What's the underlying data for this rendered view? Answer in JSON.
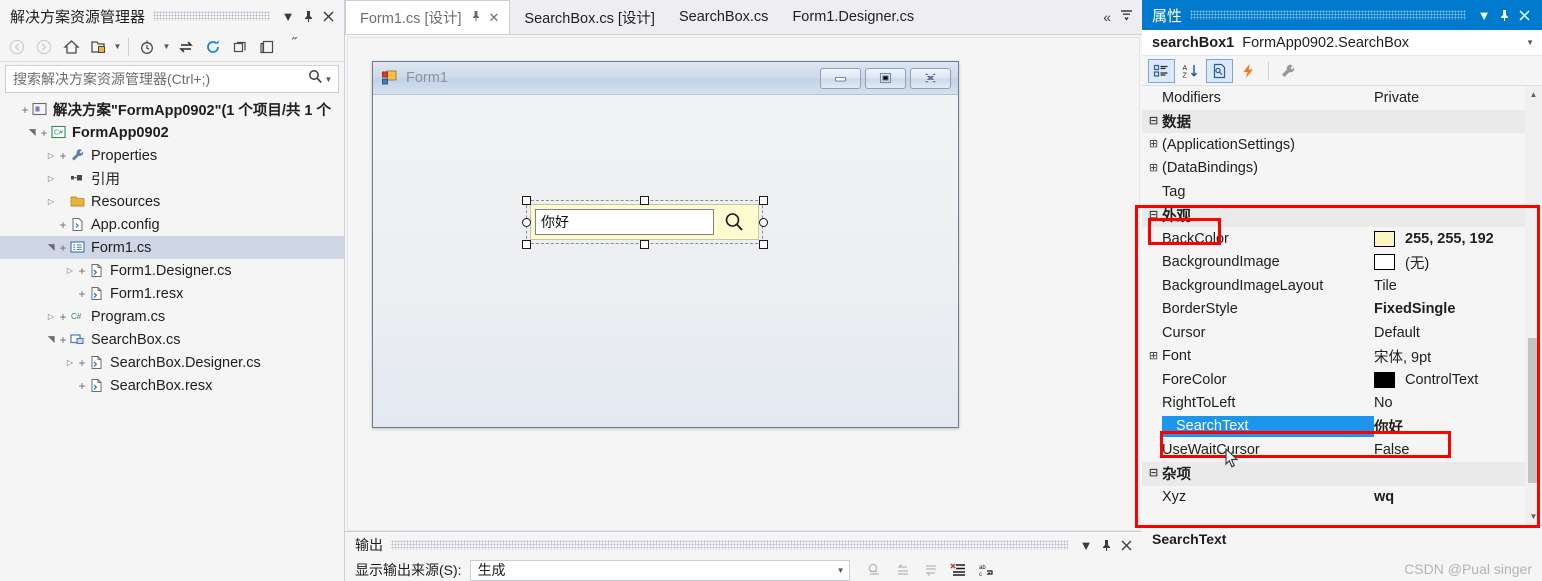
{
  "solution_explorer": {
    "title": "解决方案资源管理器",
    "titlebar_buttons": [
      "dropdown-icon",
      "pin-icon",
      "close-icon"
    ],
    "toolbar": [
      {
        "name": "back-button",
        "icon": "back-arrow-icon",
        "disabled": true
      },
      {
        "name": "forward-button",
        "icon": "forward-arrow-icon",
        "disabled": true
      },
      {
        "name": "home-button",
        "icon": "home-icon",
        "disabled": false
      },
      {
        "name": "show-all-files-button",
        "icon": "folder-open-icon",
        "disabled": false
      },
      {
        "name": "pending-changes-button",
        "icon": "clock-icon",
        "disabled": false
      },
      {
        "name": "sync-button",
        "icon": "sync-arrows-icon",
        "disabled": false
      },
      {
        "name": "refresh-button",
        "icon": "refresh-icon",
        "disabled": false
      },
      {
        "name": "collapse-all-button",
        "icon": "collapse-icon",
        "disabled": false
      },
      {
        "name": "properties-button",
        "icon": "properties-page-icon",
        "disabled": false
      },
      {
        "name": "overflow-button",
        "icon": "overflow-dots-icon",
        "disabled": false
      }
    ],
    "search": {
      "placeholder": "搜索解决方案资源管理器(Ctrl+;)",
      "icon": "search-icon",
      "caret": "dropdown-caret-icon"
    },
    "tree": [
      {
        "depth": 0,
        "expander": "",
        "plus": "+",
        "icon": "solution-icon",
        "label": "解决方案\"FormApp0902\"(1 个项目/共 1 个",
        "bold": true,
        "selected": false
      },
      {
        "depth": 1,
        "expander": "▲",
        "plus": "+",
        "icon": "csharp-project-icon",
        "label": "FormApp0902",
        "bold": true,
        "selected": false
      },
      {
        "depth": 2,
        "expander": "▷",
        "plus": "+",
        "icon": "wrench-icon",
        "label": "Properties",
        "bold": false,
        "selected": false
      },
      {
        "depth": 2,
        "expander": "▷",
        "plus": "",
        "icon": "references-icon",
        "label": "引用",
        "bold": false,
        "selected": false
      },
      {
        "depth": 2,
        "expander": "▷",
        "plus": "",
        "icon": "folder-icon",
        "label": "Resources",
        "bold": false,
        "selected": false
      },
      {
        "depth": 2,
        "expander": "",
        "plus": "+",
        "icon": "config-file-icon",
        "label": "App.config",
        "bold": false,
        "selected": false
      },
      {
        "depth": 2,
        "expander": "▲",
        "plus": "+",
        "icon": "form-icon",
        "label": "Form1.cs",
        "bold": false,
        "selected": true
      },
      {
        "depth": 3,
        "expander": "▷",
        "plus": "+",
        "icon": "csharp-file-icon",
        "label": "Form1.Designer.cs",
        "bold": false,
        "selected": false
      },
      {
        "depth": 3,
        "expander": "",
        "plus": "+",
        "icon": "csharp-file-icon",
        "label": "Form1.resx",
        "bold": false,
        "selected": false
      },
      {
        "depth": 2,
        "expander": "▷",
        "plus": "+",
        "icon": "csharp-code-icon",
        "label": "Program.cs",
        "bold": false,
        "selected": false
      },
      {
        "depth": 2,
        "expander": "▲",
        "plus": "+",
        "icon": "usercontrol-icon",
        "label": "SearchBox.cs",
        "bold": false,
        "selected": false
      },
      {
        "depth": 3,
        "expander": "▷",
        "plus": "+",
        "icon": "csharp-file-icon",
        "label": "SearchBox.Designer.cs",
        "bold": false,
        "selected": false
      },
      {
        "depth": 3,
        "expander": "",
        "plus": "+",
        "icon": "csharp-file-icon",
        "label": "SearchBox.resx",
        "bold": false,
        "selected": false
      }
    ]
  },
  "editor": {
    "tabs": [
      {
        "label": "Form1.cs [设计]",
        "active": true,
        "pinned": true,
        "closable": true
      },
      {
        "label": "SearchBox.cs [设计]",
        "active": false,
        "pinned": false,
        "closable": false
      },
      {
        "label": "SearchBox.cs",
        "active": false,
        "pinned": false,
        "closable": false
      },
      {
        "label": "Form1.Designer.cs",
        "active": false,
        "pinned": false,
        "closable": false
      }
    ],
    "tabstrip_right": [
      "chevron-double-left-icon",
      "tab-list-dropdown-icon"
    ],
    "designer": {
      "form": {
        "title": "Form1",
        "icon": "winform-icon",
        "window_buttons": [
          {
            "name": "minimize-button",
            "glyph": "minimize-icon"
          },
          {
            "name": "maximize-button",
            "glyph": "maximize-icon"
          },
          {
            "name": "close-button",
            "glyph": "close-x-icon"
          }
        ]
      },
      "selected_control": {
        "name": "searchBox1",
        "text_value": "你好",
        "button_icon": "search-magnifier-icon",
        "back_color": "#fdfbcf"
      }
    }
  },
  "output": {
    "title": "输出",
    "titlebar_buttons": [
      "dropdown-icon",
      "pin-icon",
      "close-icon"
    ],
    "source_label": "显示输出来源(S):",
    "source_value": "生成",
    "toolbar": [
      {
        "name": "find-message-button",
        "icon": "find-message-icon",
        "disabled": true
      },
      {
        "name": "go-to-previous-button",
        "icon": "arrow-up-left-icon",
        "disabled": true
      },
      {
        "name": "go-to-next-button",
        "icon": "arrow-down-left-icon",
        "disabled": true
      },
      {
        "name": "clear-all-button",
        "icon": "clear-list-icon",
        "disabled": false
      },
      {
        "name": "toggle-word-wrap-button",
        "icon": "word-wrap-icon",
        "disabled": false
      }
    ]
  },
  "properties": {
    "title": "属性",
    "titlebar_buttons": [
      "dropdown-icon",
      "pin-icon",
      "close-icon"
    ],
    "object_name": "searchBox1",
    "object_type": "FormApp0902.SearchBox",
    "object_dropdown_icon": "dropdown-caret-icon",
    "toolbar": [
      {
        "name": "categorized-button",
        "icon": "categorized-icon",
        "active": true
      },
      {
        "name": "alphabetical-button",
        "icon": "sort-az-icon",
        "active": false
      },
      {
        "name": "properties-button",
        "icon": "property-page-icon",
        "active": true
      },
      {
        "name": "events-button",
        "icon": "events-lightning-icon",
        "active": false
      },
      {
        "name": "property-pages-button",
        "icon": "wrench-icon",
        "active": false
      }
    ],
    "rows": [
      {
        "expander": "",
        "name": "Modifiers",
        "value": "Private",
        "bold": false,
        "category": false,
        "swatch": null,
        "selected": false
      },
      {
        "expander": "⊟",
        "name": "数据",
        "value": "",
        "bold": true,
        "category": true,
        "swatch": null,
        "selected": false
      },
      {
        "expander": "⊞",
        "name": "(ApplicationSettings)",
        "value": "",
        "bold": false,
        "category": false,
        "swatch": null,
        "selected": false
      },
      {
        "expander": "⊞",
        "name": "(DataBindings)",
        "value": "",
        "bold": false,
        "category": false,
        "swatch": null,
        "selected": false
      },
      {
        "expander": "",
        "name": "Tag",
        "value": "",
        "bold": false,
        "category": false,
        "swatch": null,
        "selected": false
      },
      {
        "expander": "⊟",
        "name": "外观",
        "value": "",
        "bold": true,
        "category": true,
        "swatch": null,
        "selected": false
      },
      {
        "expander": "",
        "name": "BackColor",
        "value": "255, 255, 192",
        "bold": true,
        "category": false,
        "swatch": "#fbf5c0",
        "selected": false
      },
      {
        "expander": "",
        "name": "BackgroundImage",
        "value": "(无)",
        "bold": false,
        "category": false,
        "swatch": "#ffffff",
        "selected": false
      },
      {
        "expander": "",
        "name": "BackgroundImageLayout",
        "value": "Tile",
        "bold": false,
        "category": false,
        "swatch": null,
        "selected": false
      },
      {
        "expander": "",
        "name": "BorderStyle",
        "value": "FixedSingle",
        "bold": true,
        "category": false,
        "swatch": null,
        "selected": false
      },
      {
        "expander": "",
        "name": "Cursor",
        "value": "Default",
        "bold": false,
        "category": false,
        "swatch": null,
        "selected": false
      },
      {
        "expander": "⊞",
        "name": "Font",
        "value": "宋体, 9pt",
        "bold": false,
        "category": false,
        "swatch": null,
        "selected": false
      },
      {
        "expander": "",
        "name": "ForeColor",
        "value": "ControlText",
        "bold": false,
        "category": false,
        "swatch": "#000000",
        "selected": false
      },
      {
        "expander": "",
        "name": "RightToLeft",
        "value": "No",
        "bold": false,
        "category": false,
        "swatch": null,
        "selected": false
      },
      {
        "expander": "",
        "name": "SearchText",
        "value": "你好",
        "bold": true,
        "category": false,
        "swatch": null,
        "selected": true
      },
      {
        "expander": "",
        "name": "UseWaitCursor",
        "value": "False",
        "bold": false,
        "category": false,
        "swatch": null,
        "selected": false
      },
      {
        "expander": "⊟",
        "name": "杂项",
        "value": "",
        "bold": true,
        "category": true,
        "swatch": null,
        "selected": false
      },
      {
        "expander": "",
        "name": "Xyz",
        "value": "wq",
        "bold": true,
        "category": false,
        "swatch": null,
        "selected": false
      }
    ],
    "description_title": "SearchText",
    "description_body": ""
  },
  "watermark": "CSDN @Pual singer",
  "colors": {
    "accent_blue": "#007acc",
    "selection_blue": "#1c95ed",
    "annotation_red": "#fe0000",
    "tree_selection": "#cfd6e5",
    "control_backcolor": "#fdfbcf"
  }
}
